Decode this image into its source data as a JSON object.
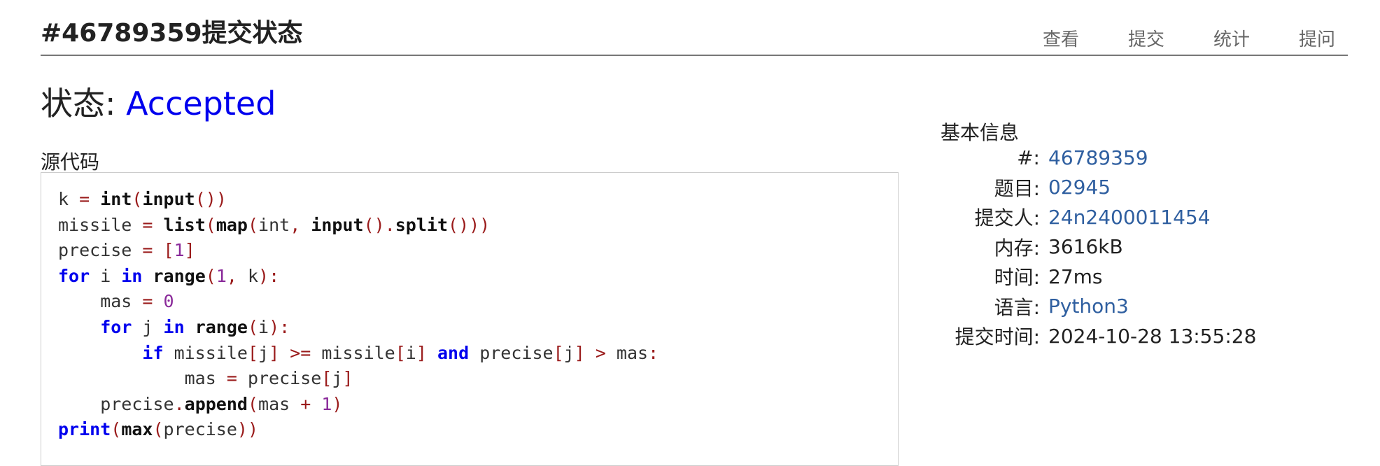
{
  "page": {
    "title": "#46789359提交状态"
  },
  "nav": {
    "items": [
      "查看",
      "提交",
      "统计",
      "提问"
    ]
  },
  "status": {
    "label": "状态: ",
    "value": "Accepted"
  },
  "source": {
    "label": "源代码",
    "language": "Python3",
    "lines": [
      "k = int(input())",
      "missile = list(map(int, input().split()))",
      "precise = [1]",
      "for i in range(1, k):",
      "    mas = 0",
      "    for j in range(i):",
      "        if missile[j] >= missile[i] and precise[j] > mas:",
      "            mas = precise[j]",
      "    precise.append(mas + 1)",
      "print(max(precise))"
    ]
  },
  "info": {
    "title": "基本信息",
    "rows": [
      {
        "key": "#:",
        "value": "46789359",
        "link": true
      },
      {
        "key": "题目:",
        "value": "02945",
        "link": true
      },
      {
        "key": "提交人:",
        "value": "24n2400011454",
        "link": true
      },
      {
        "key": "内存:",
        "value": "3616kB",
        "link": false
      },
      {
        "key": "时间:",
        "value": "27ms",
        "link": false
      },
      {
        "key": "语言:",
        "value": "Python3",
        "link": true
      },
      {
        "key": "提交时间:",
        "value": "2024-10-28 13:55:28",
        "link": false
      }
    ]
  },
  "colors": {
    "accepted": "#0000ee",
    "link": "#2f5fa0",
    "keyword": "#0000ee",
    "operator": "#9a1b1b",
    "number": "#8a2a9a"
  }
}
